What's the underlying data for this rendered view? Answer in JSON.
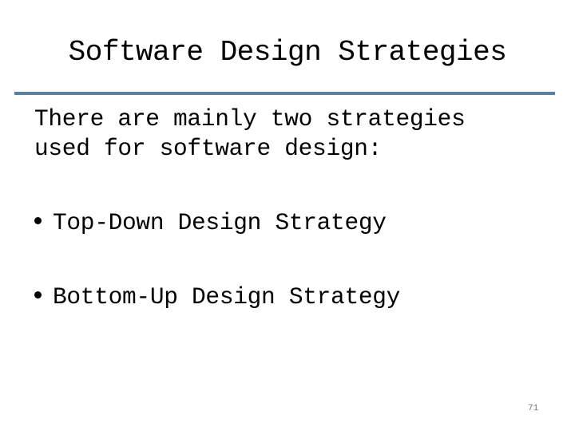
{
  "slide": {
    "title": "Software Design Strategies",
    "intro_lines": [
      "There are mainly two strategies",
      "used for software design:"
    ],
    "bullets": [
      "Top-Down Design Strategy",
      "Bottom-Up Design Strategy"
    ],
    "page_number": "71",
    "colors": {
      "divider": "#5b7fa3",
      "text": "#000000",
      "page_number": "#777777"
    }
  }
}
